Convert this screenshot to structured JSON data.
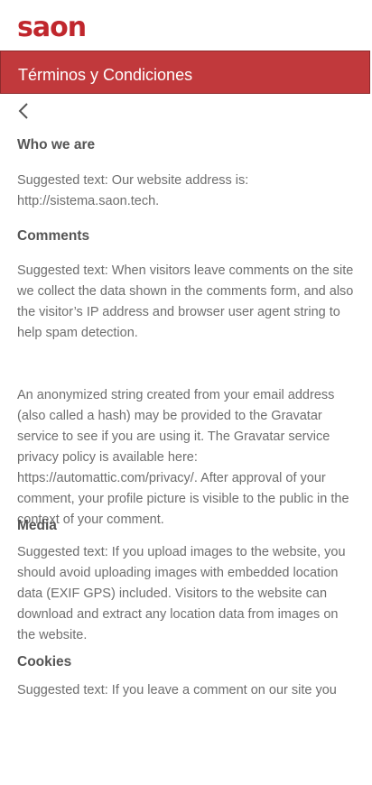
{
  "header": {
    "logo_text": "saon",
    "title": "Términos y Condiciones"
  },
  "sections": [
    {
      "heading": "Who we are",
      "text": "Suggested text: Our website address is: http://sistema.saon.tech."
    },
    {
      "heading": "Comments",
      "text": "Suggested text: When visitors leave comments on the site we collect the data shown in the comments form, and also the visitor’s IP address and browser user agent  string to help spam detection.",
      "text2": "An anonymized string created from your email address (also called a hash) may be provided to the Gravatar service to see if you are using it. The Gravatar service privacy policy is available here: https://automattic.com/privacy/. After approval of your comment, your profile picture is visible to the public in the context of your comment."
    },
    {
      "heading": "Media",
      "text": "Suggested text: If you upload images to the website, you should avoid uploading images with embedded location data (EXIF GPS) included. Visitors to the website can download and extract any location data from images on the website."
    },
    {
      "heading": "Cookies",
      "text": "Suggested text: If you leave a comment on our site you"
    }
  ],
  "colors": {
    "brand": "#c0272d",
    "titlebar": "#c1393c"
  }
}
